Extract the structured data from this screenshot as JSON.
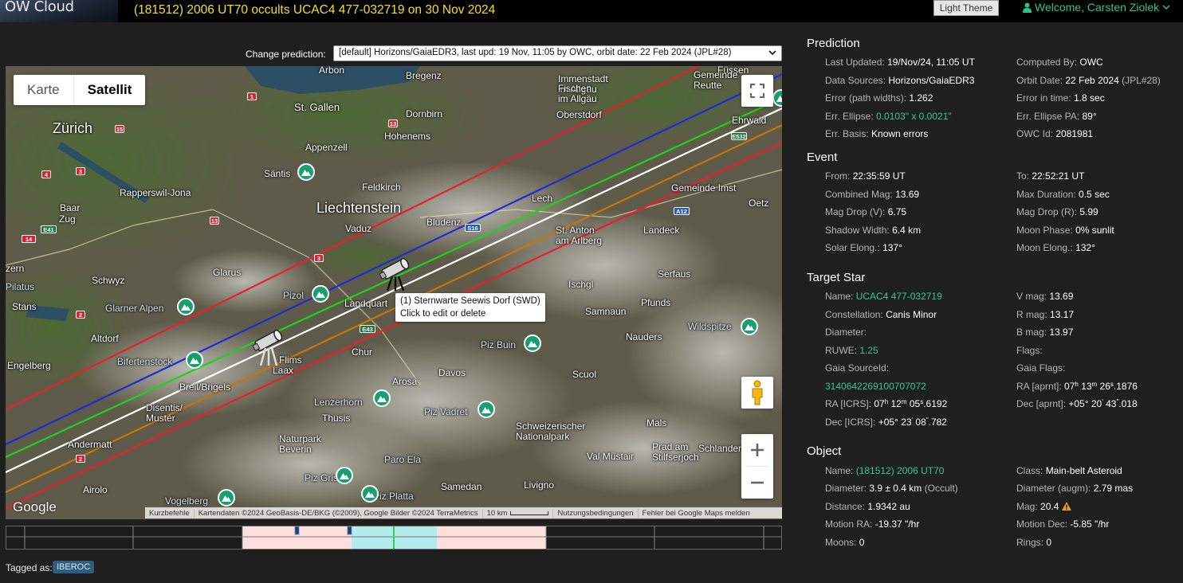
{
  "header": {
    "logo": "OW Cloud",
    "title": "(181512) 2006 UT70 occults UCAC4 477-032719 on 30 Nov 2024",
    "theme_button": "Light Theme",
    "welcome": "Welcome, Carsten Ziolek"
  },
  "prediction_select": {
    "label": "Change prediction:",
    "value": "[default] Horizons/GaiaEDR3, last upd: 19 Nov, 11:05 by OWC, orbit date: 22 Feb 2024 (JPL#28)"
  },
  "map": {
    "type_buttons": [
      "Karte",
      "Satellit"
    ],
    "active_type": "Satellit",
    "tooltip_line1": "(1) Sternwarte Seewis Dorf (SWD)",
    "tooltip_line2": "Click to edit or delete",
    "footer": [
      "Kurzbefehle",
      "Kartendaten ©2024 GeoBasis-DE/BKG (©2009), Google Bilder ©2024 TerraMetrics",
      "10 km",
      "Nutzungsbedingungen",
      "Fehler bei Google Maps melden"
    ],
    "google": "Google",
    "labels": {
      "zurich": "Zürich",
      "liechtenstein": "Liechtenstein",
      "stgallen": "St. Gallen",
      "arbon": "Arbon",
      "bregenz": "Bregenz",
      "dornbirn": "Dornbirn",
      "hohenems": "Hohenems",
      "appenzell": "Appenzell",
      "santis": "Säntis",
      "feldkirch": "Feldkirch",
      "vaduz": "Vaduz",
      "bludenz": "Bludenz",
      "rapperswil": "Rapperswil-Jona",
      "glarus": "Glarus",
      "schwyz": "Schwyz",
      "pilatus": "Pilatus",
      "stans": "Stans",
      "glarneralpen": "Glarner Alpen",
      "altdorf": "Altdorf",
      "engelberg": "Engelberg",
      "bifertenstock": "Bifertenstock",
      "pizol": "Pizol",
      "landquart": "Landquart",
      "chur": "Chur",
      "flims": "Flims",
      "laax": "Laax",
      "breil": "Breil/Brigels",
      "disentis": "Disentis/\nMustér",
      "davos": "Davos",
      "arosa": "Arosa",
      "lenzerhorn": "Lenzerhorn",
      "thusis": "Thusis",
      "pizbuin": "Piz Buin",
      "scuol": "Scuol",
      "pizvadret": "Piz Vadret",
      "nationalpark": "Schweizerischer\nNationalpark",
      "naturpark": "Naturpark\nBeverin",
      "paroela": "Paro Ela",
      "pizgrisch": "Piz Grisch",
      "pizplatta": "Piz Platta",
      "samedan": "Samedan",
      "livigno": "Livigno",
      "valmustair": "Val Müstair",
      "pradam": "Prad am\nStilfserjoch",
      "mals": "Mals",
      "schlander": "Schlander",
      "lech": "Lech",
      "stanton": "St. Anton\nam Arlberg",
      "landeck": "Landeck",
      "gemeindeimst": "Gemeinde Imst",
      "oetz": "Oetz",
      "serfaus": "Serfaus",
      "pfunds": "Pfunds",
      "samnaun": "Samnaun",
      "ischgl": "Ischgl",
      "nauders": "Nauders",
      "wildspitze": "Wildspitze",
      "fussen": "Füssen",
      "immenstadt": "Immenstadt\nim Allgäu",
      "fischen": "Fischen\nim Allgäu",
      "oberstdorf": "Oberstdorf",
      "ehrwald": "Ehrwald",
      "reutte": "Gemeinde\nReutte",
      "lenzburg": "Baar",
      "zug": "Zug",
      "uzern": "zern",
      "andermatt": "Andermatt",
      "airolo": "Airolo",
      "vogelberg": "Vogelberg",
      "e41": "E41",
      "e43": "E43",
      "e532": "E532",
      "a12": "A12",
      "s16": "S16"
    }
  },
  "timeline": {},
  "tags": {
    "label": "Tagged as:",
    "badge": "IBEROC"
  },
  "panel": {
    "prediction": {
      "title": "Prediction",
      "last_updated_k": "Last Updated:",
      "last_updated_v": "19/Nov/24, 11:05 UT",
      "computed_by_k": "Computed By:",
      "computed_by_v": "OWC",
      "data_sources_k": "Data Sources:",
      "data_sources_v": "Horizons/GaiaEDR3",
      "orbit_date_k": "Orbit Date:",
      "orbit_date_v": "22 Feb 2024",
      "orbit_date_extra": "(JPL#28)",
      "error_k": "Error (path widths):",
      "error_v": "1.262",
      "error_time_k": "Error in time:",
      "error_time_v": "1.8 sec",
      "err_ellipse_k": "Err. Ellipse:",
      "err_ellipse_v": "0.0103\" x 0.0021\"",
      "err_ellipse_pa_k": "Err. Ellipse PA:",
      "err_ellipse_pa_v": "89°",
      "err_basis_k": "Err. Basis:",
      "err_basis_v": "Known errors",
      "owc_id_k": "OWC Id:",
      "owc_id_v": "2081981"
    },
    "event": {
      "title": "Event",
      "from_k": "From:",
      "from_v": "22:35:59 UT",
      "to_k": "To:",
      "to_v": "22:52:21 UT",
      "combined_mag_k": "Combined Mag:",
      "combined_mag_v": "13.69",
      "max_duration_k": "Max Duration:",
      "max_duration_v": "0.5 sec",
      "mag_drop_v_k": "Mag Drop (V):",
      "mag_drop_v_v": "6.75",
      "mag_drop_r_k": "Mag Drop (R):",
      "mag_drop_r_v": "5.99",
      "shadow_width_k": "Shadow Width:",
      "shadow_width_v": "6.4 km",
      "moon_phase_k": "Moon Phase:",
      "moon_phase_v": "0% sunlit",
      "solar_elong_k": "Solar Elong.:",
      "solar_elong_v": "137°",
      "moon_elong_k": "Moon Elong.:",
      "moon_elong_v": "132°"
    },
    "target_star": {
      "title": "Target Star",
      "name_k": "Name:",
      "name_v": "UCAC4 477-032719",
      "vmag_k": "V mag:",
      "vmag_v": "13.69",
      "constellation_k": "Constellation:",
      "constellation_v": "Canis Minor",
      "rmag_k": "R mag:",
      "rmag_v": "13.17",
      "diameter_k": "Diameter:",
      "bmag_k": "B mag:",
      "bmag_v": "13.97",
      "ruwe_k": "RUWE:",
      "ruwe_v": "1.25",
      "flags_k": "Flags:",
      "gaia_sourceid_k": "Gaia SourceId:",
      "gaia_flags_k": "Gaia Flags:",
      "gaia_sourceid_v": "3140642269100707072",
      "ra_aprnt_k": "RA [aprnt]:",
      "ra_aprnt": [
        "07",
        "h",
        " 13",
        "m",
        " 26",
        "s",
        ".1876"
      ],
      "ra_icrs_k": "RA [ICRS]:",
      "ra_icrs": [
        "07",
        "h",
        " 12",
        "m",
        " 05",
        "s",
        ".6192"
      ],
      "dec_aprnt_k": "Dec [aprnt]:",
      "dec_aprnt": [
        "+05° 20",
        "'",
        " 43",
        "\"",
        ".018"
      ],
      "dec_icrs_k": "Dec [ICRS]:",
      "dec_icrs": [
        "+05° 23",
        "'",
        " 08",
        "\"",
        ".782"
      ]
    },
    "object": {
      "title": "Object",
      "name_k": "Name:",
      "name_v": "(181512) 2006 UT70",
      "class_k": "Class:",
      "class_v": "Main-belt Asteroid",
      "diameter_k": "Diameter:",
      "diameter_v": "3.9 ± 0.4 km",
      "diameter_extra": "(Occult)",
      "diameter_augm_k": "Diameter (augm):",
      "diameter_augm_v": "2.79 mas",
      "distance_k": "Distance:",
      "distance_v": "1.9342 au",
      "mag_k": "Mag:",
      "mag_v": "20.4",
      "motion_ra_k": "Motion RA:",
      "motion_ra_v": "-19.37 \"/hr",
      "motion_dec_k": "Motion Dec:",
      "motion_dec_v": "-5.85 \"/hr",
      "moons_k": "Moons:",
      "moons_v": "0",
      "rings_k": "Rings:",
      "rings_v": "0"
    }
  },
  "colors": {
    "accent": "#36c794",
    "title_yellow": "#f5e020",
    "path_red": "#e8202a",
    "path_blue": "#1d2bd6",
    "path_green": "#1fd11a",
    "path_white": "#ffffff",
    "path_orange": "#c9730c"
  },
  "icons": {
    "user": "user-icon",
    "chevron": "chevron-down-icon",
    "fullscreen": "fullscreen-icon",
    "pegman": "pegman-icon",
    "zoom_in": "plus-icon",
    "zoom_out": "minus-icon",
    "warning": "warning-icon",
    "telescope": "telescope-icon",
    "mountain": "mountain-icon"
  }
}
